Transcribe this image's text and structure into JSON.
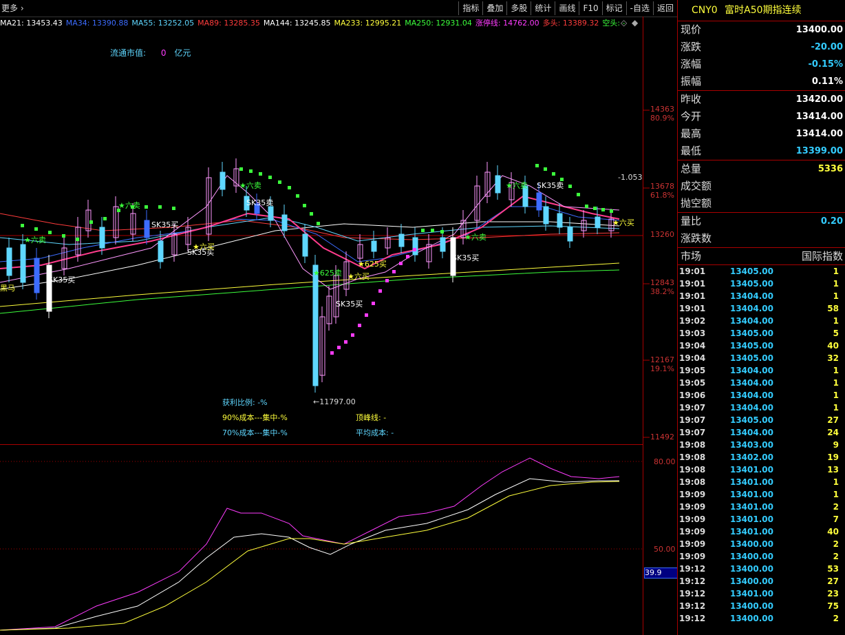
{
  "toolbar": {
    "more_label": "更多",
    "buttons": [
      "指标",
      "叠加",
      "多股",
      "统计",
      "画线",
      "F10",
      "标记",
      "-自选",
      "返回"
    ]
  },
  "ma_legend": [
    {
      "text": "MA21: 13453.43",
      "color": "#ffffff"
    },
    {
      "text": "MA34: 13390.88",
      "color": "#3c6cff"
    },
    {
      "text": "MA55: 13252.05",
      "color": "#5fd7ff"
    },
    {
      "text": "MA89: 13285.35",
      "color": "#ff3c3c"
    },
    {
      "text": "MA144: 13245.85",
      "color": "#ffffff"
    },
    {
      "text": "MA233: 12995.21",
      "color": "#ffff3c"
    },
    {
      "text": "MA250: 12931.04",
      "color": "#3cff3c"
    },
    {
      "text": "涨停线: 14762.00",
      "color": "#ff3cff"
    },
    {
      "text": "多头: 13389.32",
      "color": "#ff3c3c"
    },
    {
      "text": "空头: -",
      "color": "#3cff3c"
    }
  ],
  "market_cap": {
    "label": "流通市值:",
    "value": "0",
    "unit": "亿元"
  },
  "y_axis": [
    {
      "price": "14363",
      "pct": "80.9%"
    },
    {
      "price": "13678",
      "pct": "61.8%"
    },
    {
      "price": "13260",
      "pct": ""
    },
    {
      "price": "12843",
      "pct": "38.2%"
    },
    {
      "price": "12167",
      "pct": "19.1%"
    },
    {
      "price": "11492",
      "pct": ""
    }
  ],
  "annot_value": "-1.053",
  "low_label": "11797.00",
  "chip_info": {
    "profit": "获利比例: -%",
    "cost90": "90%成本---集中-%",
    "cost70": "70%成本---集中-%",
    "peak": "顶峰线: -",
    "avg": "平均成本: -"
  },
  "sub_axis": [
    "80.00",
    "50.00",
    "39.9"
  ],
  "chart_text": {
    "six_sell": "★六卖",
    "six_buy": "★六买",
    "sk35_buy": "SK35买",
    "sk35_sell": "SK35卖",
    "sell625": "★625卖",
    "buy625": "★625买",
    "dark_horse": "黑马",
    "six_buy_tag": "六买"
  },
  "quote": {
    "code": "CNY0",
    "name": "富时A50期指连续",
    "rows": [
      {
        "label": "现价",
        "value": "13400.00",
        "color": "#ffffff"
      },
      {
        "label": "涨跌",
        "value": "-20.00",
        "color": "#3cf"
      },
      {
        "label": "涨幅",
        "value": "-0.15%",
        "color": "#3cf"
      },
      {
        "label": "振幅",
        "value": "0.11%",
        "color": "#ffffff"
      },
      {
        "label": "昨收",
        "value": "13420.00",
        "color": "#ffffff"
      },
      {
        "label": "今开",
        "value": "13414.00",
        "color": "#ffffff"
      },
      {
        "label": "最高",
        "value": "13414.00",
        "color": "#ffffff"
      },
      {
        "label": "最低",
        "value": "13399.00",
        "color": "#3cf"
      },
      {
        "label": "总量",
        "value": "5336",
        "color": "#ffff3c"
      },
      {
        "label": "成交额",
        "value": "",
        "color": "#ffffff"
      },
      {
        "label": "抛空额",
        "value": "",
        "color": "#ffffff"
      },
      {
        "label": "量比",
        "value": "0.20",
        "color": "#3cf"
      },
      {
        "label": "涨跌数",
        "value": "",
        "color": "#ffffff"
      }
    ],
    "market_label": "市场",
    "market_value": "国际指数"
  },
  "ticks": [
    [
      "19:01",
      "13405.00",
      "1"
    ],
    [
      "19:01",
      "13405.00",
      "1"
    ],
    [
      "19:01",
      "13404.00",
      "1"
    ],
    [
      "19:01",
      "13404.00",
      "58"
    ],
    [
      "19:02",
      "13404.00",
      "1"
    ],
    [
      "19:03",
      "13405.00",
      "5"
    ],
    [
      "19:04",
      "13405.00",
      "40"
    ],
    [
      "19:04",
      "13405.00",
      "32"
    ],
    [
      "19:05",
      "13404.00",
      "1"
    ],
    [
      "19:05",
      "13404.00",
      "1"
    ],
    [
      "19:06",
      "13404.00",
      "1"
    ],
    [
      "19:07",
      "13404.00",
      "1"
    ],
    [
      "19:07",
      "13405.00",
      "27"
    ],
    [
      "19:07",
      "13404.00",
      "24"
    ],
    [
      "19:08",
      "13403.00",
      "9"
    ],
    [
      "19:08",
      "13402.00",
      "19"
    ],
    [
      "19:08",
      "13401.00",
      "13"
    ],
    [
      "19:08",
      "13401.00",
      "1"
    ],
    [
      "19:09",
      "13401.00",
      "1"
    ],
    [
      "19:09",
      "13401.00",
      "2"
    ],
    [
      "19:09",
      "13401.00",
      "7"
    ],
    [
      "19:09",
      "13401.00",
      "40"
    ],
    [
      "19:09",
      "13400.00",
      "2"
    ],
    [
      "19:09",
      "13400.00",
      "2"
    ],
    [
      "19:12",
      "13400.00",
      "53"
    ],
    [
      "19:12",
      "13400.00",
      "27"
    ],
    [
      "19:12",
      "13401.00",
      "23"
    ],
    [
      "19:12",
      "13400.00",
      "75"
    ],
    [
      "19:12",
      "13400.00",
      "2"
    ]
  ]
}
